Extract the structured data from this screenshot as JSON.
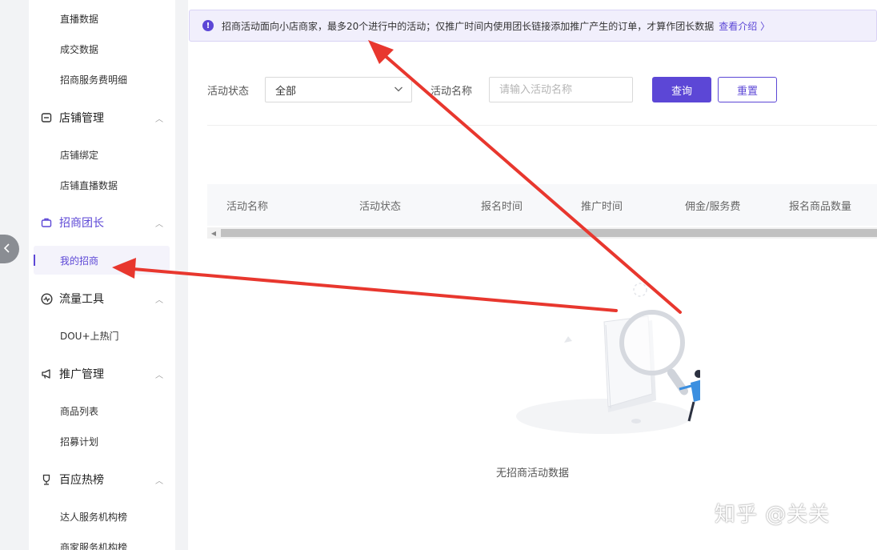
{
  "sidebar": {
    "items_top": [
      "直播数据",
      "成交数据",
      "招商服务费明细"
    ],
    "group_store": {
      "label": "店铺管理",
      "icon": "store-icon",
      "items": [
        "店铺绑定",
        "店铺直播数据"
      ]
    },
    "group_recruit": {
      "label": "招商团长",
      "icon": "bag-icon",
      "items": [
        "我的招商"
      ]
    },
    "group_traffic": {
      "label": "流量工具",
      "icon": "pulse-icon",
      "items": [
        "DOU+上热门"
      ]
    },
    "group_promo": {
      "label": "推广管理",
      "icon": "megaphone-icon",
      "items": [
        "商品列表",
        "招募计划"
      ]
    },
    "group_rank": {
      "label": "百应热榜",
      "icon": "trophy-icon",
      "items": [
        "达人服务机构榜",
        "商家服务机构榜"
      ]
    },
    "active_color": "#5c47d6"
  },
  "notice": {
    "text": "招商活动面向小店商家，最多20个进行中的活动；仅推广时间内使用团长链接添加推广产生的订单，才算作团长数据",
    "link": "查看介绍",
    "icon": "info-icon"
  },
  "filters": {
    "status_label": "活动状态",
    "status_value": "全部",
    "name_label": "活动名称",
    "name_placeholder": "请输入活动名称",
    "query_button": "查询",
    "reset_button": "重置"
  },
  "table": {
    "columns": [
      "活动名称",
      "活动状态",
      "报名时间",
      "推广时间",
      "佣金/服务费",
      "报名商品数量"
    ]
  },
  "empty": {
    "text": "无招商活动数据"
  },
  "watermark": "知乎 @关关",
  "colors": {
    "primary": "#5c47d6",
    "annotation_arrow": "#e8372e"
  }
}
